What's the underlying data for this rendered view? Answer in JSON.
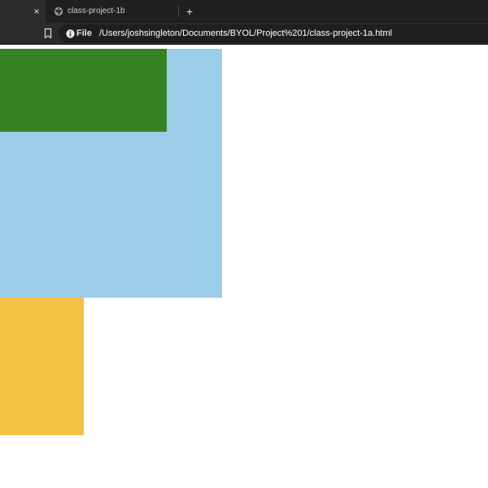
{
  "browser": {
    "tabs": [
      {
        "title": "",
        "active": true
      },
      {
        "title": "class-project-1b",
        "active": false
      }
    ],
    "close_glyph": "×",
    "new_tab_glyph": "+",
    "address_bar": {
      "scheme_label": "File",
      "url": "/Users/joshsingleton/Documents/BYOL/Project%201/class-project-1a.html"
    },
    "icons": {
      "tab_favicon": "globe-icon",
      "bookmark": "bookmark-icon",
      "site_info": "info-icon"
    }
  },
  "page": {
    "colors": {
      "blue": "#9ccde9",
      "green": "#358225",
      "yellow": "#f4c242",
      "background": "#ffffff"
    }
  }
}
